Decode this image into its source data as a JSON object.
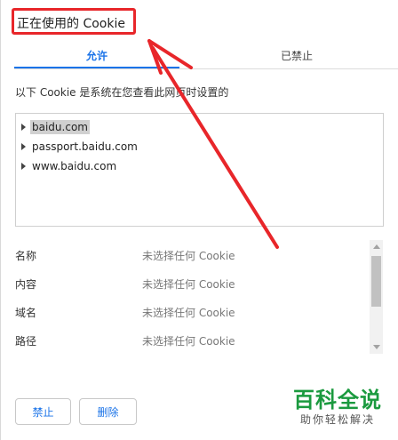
{
  "dialog": {
    "title": "正在使用的 Cookie"
  },
  "tabs": [
    {
      "label": "允许",
      "active": true
    },
    {
      "label": "已禁止",
      "active": false
    }
  ],
  "description": "以下 Cookie 是系统在您查看此网页时设置的",
  "tree": {
    "items": [
      {
        "label": "baidu.com",
        "selected": true
      },
      {
        "label": "passport.baidu.com",
        "selected": false
      },
      {
        "label": "www.baidu.com",
        "selected": false
      }
    ]
  },
  "details": {
    "rows": [
      {
        "key": "名称",
        "value": "未选择任何 Cookie"
      },
      {
        "key": "内容",
        "value": "未选择任何 Cookie"
      },
      {
        "key": "域名",
        "value": "未选择任何 Cookie"
      },
      {
        "key": "路径",
        "value": "未选择任何 Cookie"
      }
    ]
  },
  "buttons": {
    "block_label": "禁止",
    "delete_label": "删除"
  },
  "watermark": {
    "logo_text": "百科全说",
    "sub_text": "助你轻松解决"
  },
  "colors": {
    "accent": "#1a73e8",
    "highlight_red": "#e8262a",
    "watermark_green": "#1b9a3f"
  },
  "icons": [
    "expand-arrow-icon",
    "scroll-up-icon",
    "scroll-down-icon"
  ]
}
